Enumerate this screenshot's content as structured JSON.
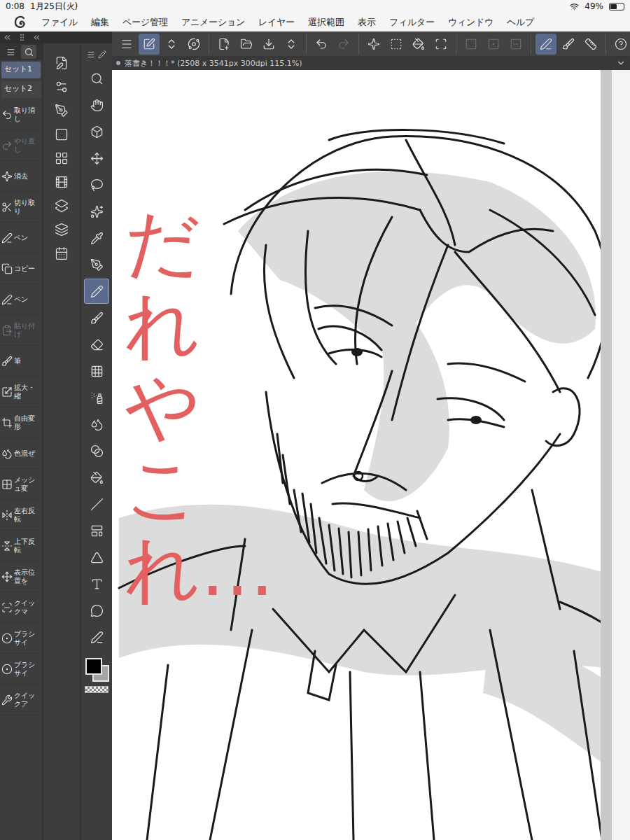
{
  "status_bar": {
    "time": "0:08",
    "date": "1月25日(火)",
    "battery": "49%",
    "battery_level": 0.49
  },
  "menu_bar": {
    "items": [
      "ファイル",
      "編集",
      "ページ管理",
      "アニメーション",
      "レイヤー",
      "選択範囲",
      "表示",
      "フィルター",
      "ウィンドウ",
      "ヘルプ"
    ]
  },
  "command_bar": {
    "groups": [
      [
        {
          "selected": false,
          "disabled": false
        },
        {
          "selected": true,
          "disabled": false
        },
        {
          "selected": false,
          "disabled": false
        },
        {
          "selected": false,
          "disabled": false
        }
      ],
      [
        {
          "selected": false,
          "disabled": false
        },
        {
          "selected": false,
          "disabled": false
        },
        {
          "selected": false,
          "disabled": false
        },
        {
          "selected": false,
          "disabled": false
        }
      ],
      [
        {
          "selected": false,
          "disabled": false
        },
        {
          "selected": false,
          "disabled": true
        }
      ],
      [
        {
          "selected": false,
          "disabled": false
        },
        {
          "selected": false,
          "disabled": false
        },
        {
          "selected": false,
          "disabled": false
        },
        {
          "selected": false,
          "disabled": false
        }
      ],
      [
        {
          "selected": false,
          "disabled": true
        },
        {
          "selected": false,
          "disabled": true
        },
        {
          "selected": false,
          "disabled": true
        }
      ],
      [
        {
          "selected": true,
          "disabled": false
        },
        {
          "selected": false,
          "disabled": false
        },
        {
          "selected": false,
          "disabled": false
        }
      ],
      [
        {
          "selected": false,
          "disabled": false
        }
      ]
    ]
  },
  "quick_access": {
    "tabs": [
      {
        "selected": false
      },
      {
        "selected": true
      }
    ],
    "sets": [
      {
        "label": "セット1",
        "selected": true
      },
      {
        "label": "セット2",
        "selected": false
      }
    ],
    "items": [
      {
        "label": "取り消し",
        "disabled": false
      },
      {
        "label": "やり直し",
        "disabled": true
      },
      {
        "label": "消去",
        "disabled": false
      },
      {
        "label": "切り取り",
        "disabled": false
      },
      {
        "label": "ペン",
        "disabled": false
      },
      {
        "label": "コピー",
        "disabled": false
      },
      {
        "label": "ペン",
        "disabled": false
      },
      {
        "label": "貼り付け",
        "disabled": true
      },
      {
        "label": "筆",
        "disabled": false
      },
      {
        "label": "拡大・縮",
        "disabled": false
      },
      {
        "label": "自由変形",
        "disabled": false
      },
      {
        "label": "色混ぜ",
        "disabled": false
      },
      {
        "label": "メッシュ変",
        "disabled": false
      },
      {
        "label": "左右反転",
        "disabled": false
      },
      {
        "label": "上下反転",
        "disabled": false
      },
      {
        "label": "表示位置を",
        "disabled": false
      },
      {
        "label": "クイックマ",
        "disabled": false
      },
      {
        "label": "ブラシサイ",
        "disabled": false
      },
      {
        "label": "ブラシサイ",
        "disabled": false
      },
      {
        "label": "クイックア",
        "disabled": false
      }
    ]
  },
  "tools": {
    "items": [
      {
        "selected": false
      },
      {
        "selected": false
      },
      {
        "selected": false
      },
      {
        "selected": false
      },
      {
        "selected": false
      },
      {
        "selected": false
      },
      {
        "selected": false
      },
      {
        "selected": false
      },
      {
        "selected": true
      },
      {
        "selected": false
      },
      {
        "selected": false
      },
      {
        "selected": false
      },
      {
        "selected": false
      },
      {
        "selected": false
      },
      {
        "selected": false
      },
      {
        "selected": false
      },
      {
        "selected": false
      },
      {
        "selected": false
      },
      {
        "selected": false
      },
      {
        "selected": false
      },
      {
        "selected": false
      },
      {
        "selected": false
      }
    ]
  },
  "swatches": [
    {
      "color": "#000000",
      "selected": true
    },
    {
      "color": "#a3a3a3",
      "selected": false
    }
  ],
  "document": {
    "title": "落書き！！！* (2508 x 3541px 300dpi 115.1%)",
    "modified": true
  },
  "canvas": {
    "annotation": "だれやこれ…"
  }
}
